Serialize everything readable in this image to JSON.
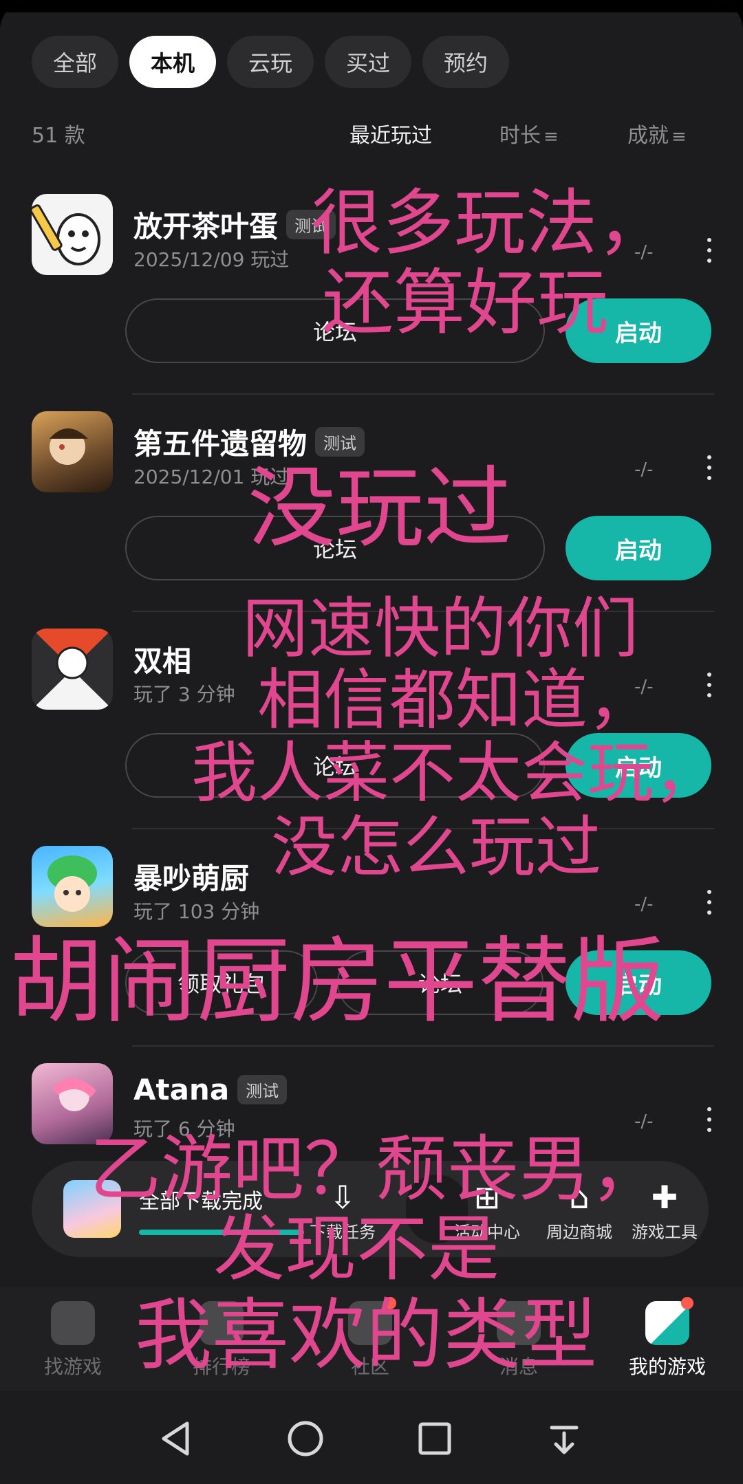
{
  "tabs": [
    "全部",
    "本机",
    "云玩",
    "买过",
    "预约"
  ],
  "active_tab": "本机",
  "sort": {
    "count": "51 款",
    "recent": "最近玩过",
    "duration": "时长",
    "achievement": "成就",
    "sort_icon": "≡"
  },
  "games": [
    {
      "name": "放开茶叶蛋",
      "badge": "测试",
      "sub": "2025/12/09 玩过",
      "dash": "-/-",
      "forum": "论坛",
      "launch": "启动"
    },
    {
      "name": "第五件遗留物",
      "badge": "测试",
      "sub": "2025/12/01 玩过",
      "dash": "-/-",
      "forum": "论坛",
      "launch": "启动"
    },
    {
      "name": "双相",
      "badge": "",
      "sub": "玩了 3 分钟",
      "dash": "-/-",
      "forum": "论坛",
      "launch": "启动"
    },
    {
      "name": "暴吵萌厨",
      "badge": "",
      "sub": "玩了 103 分钟",
      "dash": "-/-",
      "forum": "论坛",
      "launch": "启动",
      "gift": "领取礼包"
    },
    {
      "name": "Atana",
      "badge": "测试",
      "sub": "玩了 6 分钟",
      "dash": "-/-"
    }
  ],
  "download_bar": {
    "status": "全部下载完成",
    "progress": 1.0,
    "items": [
      "下载任务",
      "活动中心",
      "周边商城",
      "游戏工具"
    ]
  },
  "bottom_nav": {
    "items": [
      "找游戏",
      "排行榜",
      "社区",
      "消息",
      "我的游戏"
    ],
    "active": "我的游戏"
  },
  "overlay_captions": [
    "很多玩法，",
    "还算好玩",
    "没玩过",
    "网速快的你们",
    "相信都知道，",
    "我人菜不太会玩，",
    "没怎么玩过",
    "胡闹厨房平替版",
    "乙游吧？颓丧男，",
    "发现不是",
    "我喜欢的类型"
  ],
  "colors": {
    "accent": "#16b6a8",
    "caption": "#e0478f",
    "background": "#1c1c1e"
  }
}
